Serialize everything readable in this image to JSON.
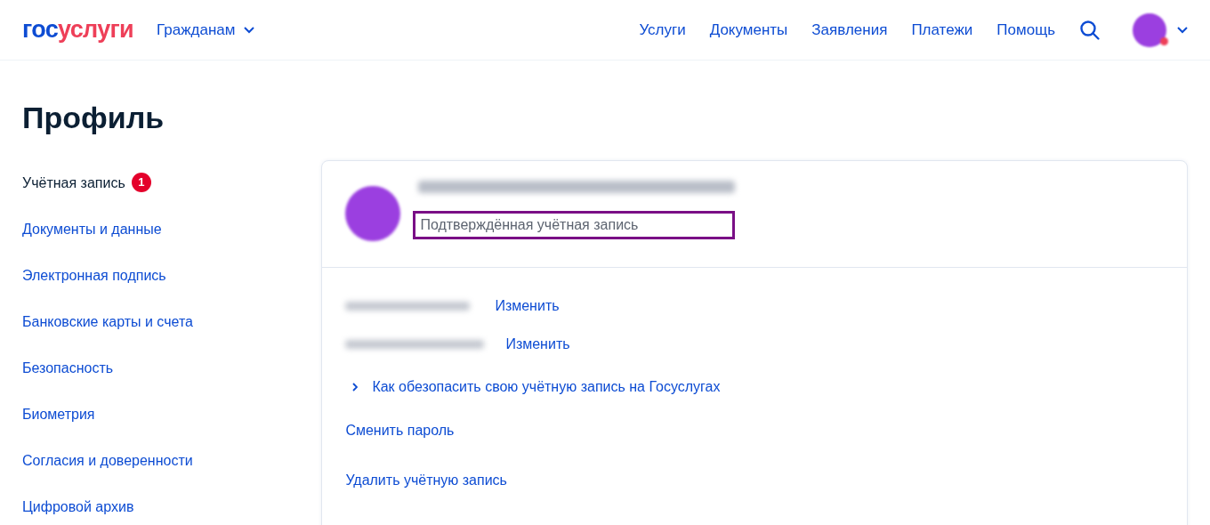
{
  "header": {
    "logo": {
      "part_1": "гос",
      "part_2": "услуги"
    },
    "audience_menu": "Гражданам",
    "nav": [
      "Услуги",
      "Документы",
      "Заявления",
      "Платежи",
      "Помощь"
    ],
    "avatar_notification": true
  },
  "page_title": "Профиль",
  "sidebar": {
    "items": [
      {
        "label": "Учётная запись",
        "selected": true,
        "badge": "1"
      },
      {
        "label": "Документы и данные",
        "selected": false
      },
      {
        "label": "Электронная подпись",
        "selected": false
      },
      {
        "label": "Банковские карты и счета",
        "selected": false
      },
      {
        "label": "Безопасность",
        "selected": false
      },
      {
        "label": "Биометрия",
        "selected": false
      },
      {
        "label": "Согласия и доверенности",
        "selected": false
      },
      {
        "label": "Цифровой архив",
        "selected": false
      }
    ]
  },
  "profile": {
    "status": "Подтверждённая учётная запись",
    "status_highlighted": true,
    "contacts": [
      {
        "action": "Изменить"
      },
      {
        "action": "Изменить"
      }
    ],
    "security_tip": "Как обезопасить свою учётную запись на Госуслугах",
    "actions": [
      "Сменить пароль",
      "Удалить учётную запись"
    ]
  }
}
